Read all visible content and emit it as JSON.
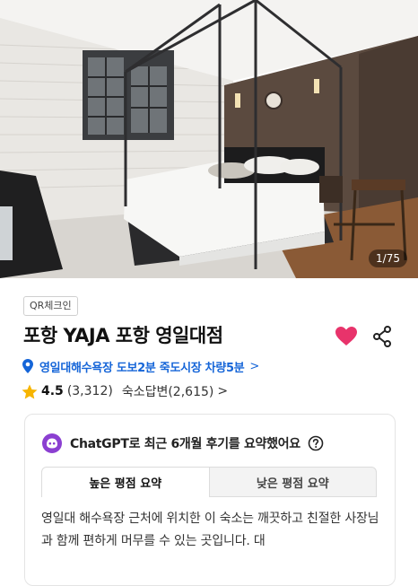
{
  "hero": {
    "photo_counter": "1/75"
  },
  "listing": {
    "qr_badge": "QR체크인",
    "title": "포항 YAJA 포항 영일대점",
    "location": "영일대해수욕장 도보2분 죽도시장 차량5분",
    "location_chevron": ">",
    "rating": "4.5",
    "rating_count": "(3,312)",
    "reply_count": "숙소답변(2,615)",
    "reply_chevron": ">"
  },
  "summary": {
    "title": "ChatGPT로 최근 6개월 후기를 요약했어요",
    "tabs": [
      "높은 평점 요약",
      "낮은 평점 요약"
    ],
    "text": "영일대 해수욕장 근처에 위치한 이 숙소는 깨끗하고 친절한 사장님과 함께 편하게 머무를 수 있는 곳입니다. 대"
  },
  "colors": {
    "heart": "#e8336b",
    "link_blue": "#1565d8",
    "star": "#f7b500",
    "chatgpt_purple": "#8b3fd1"
  }
}
